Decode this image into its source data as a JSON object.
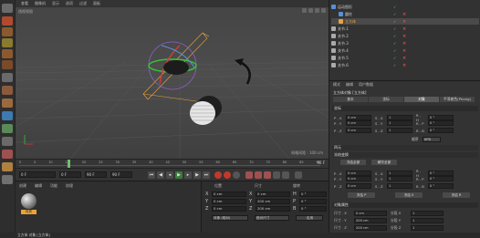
{
  "viewport": {
    "menu": [
      "查看",
      "摄像机",
      "显示",
      "选项",
      "过滤",
      "面板"
    ],
    "label": "透视视图",
    "info": "网格间距 : 100 cm"
  },
  "timeline": {
    "ticks": [
      "0",
      "5",
      "10",
      "15",
      "20",
      "25",
      "30",
      "35",
      "40",
      "45",
      "50",
      "55",
      "60",
      "65",
      "70",
      "75",
      "80",
      "85",
      "90"
    ],
    "frame_end": "90 F"
  },
  "transport": {
    "start": "0 F",
    "current": "0 F",
    "end": "90 F",
    "end2": "90 F"
  },
  "materials": {
    "menu": [
      "创建",
      "编辑",
      "功能",
      "纹理"
    ],
    "material_name": "材质"
  },
  "coords": {
    "headers": [
      "位置",
      "尺寸",
      "旋转"
    ],
    "rows": [
      {
        "axis": "X",
        "pos": "0 cm",
        "size": "0 cm",
        "rot_axis": "H",
        "rot": "0 °"
      },
      {
        "axis": "Y",
        "pos": "0 cm",
        "size": "200 cm",
        "rot_axis": "P",
        "rot": "0 °"
      },
      {
        "axis": "Z",
        "pos": "0 cm",
        "size": "200 cm",
        "rot_axis": "B",
        "rot": "0 °"
      }
    ],
    "mode1": "对象 (相对)",
    "mode2": "绝对尺寸",
    "apply": "应用"
  },
  "status": "立方体 对象 [立方体]",
  "objects": {
    "items": [
      {
        "name": "运动图形",
        "indent": 0,
        "color": "#5b8fd8"
      },
      {
        "name": "圆柱",
        "indent": 1,
        "color": "#5b8fd8"
      },
      {
        "name": "立方体",
        "indent": 1,
        "color": "#e8a33c",
        "selected": true
      },
      {
        "name": "关节.1",
        "indent": 0,
        "color": "#aaa"
      },
      {
        "name": "关节.2",
        "indent": 0,
        "color": "#aaa"
      },
      {
        "name": "关节.3",
        "indent": 0,
        "color": "#aaa"
      },
      {
        "name": "关节.4",
        "indent": 0,
        "color": "#aaa"
      },
      {
        "name": "关节.5",
        "indent": 0,
        "color": "#aaa"
      },
      {
        "name": "关节.6",
        "indent": 0,
        "color": "#aaa"
      }
    ]
  },
  "attributes": {
    "menu": [
      "模式",
      "编辑",
      "用户数据"
    ],
    "object_title": "立方体对象 [立方体]",
    "tabs": [
      "基本",
      "坐标",
      "对象",
      "平滑着色(Phong)"
    ],
    "coords_section": "坐标",
    "pos_rows": [
      {
        "p": "P . X",
        "pv": "0 cm",
        "s": "S . X",
        "sv": "1",
        "r": "R . H",
        "rv": "0 °"
      },
      {
        "p": "P . Y",
        "pv": "0 cm",
        "s": "S . Y",
        "sv": "1",
        "r": "R . P",
        "rv": "0 °"
      },
      {
        "p": "P . Z",
        "pv": "0 cm",
        "s": "S . Z",
        "sv": "1",
        "r": "R . B",
        "rv": "0 °"
      }
    ],
    "order_label": "顺序",
    "order_value": "HPB",
    "quat": "四元",
    "freeze_section": "冻结变换",
    "freeze_all": "冻结全部",
    "unfreeze_all": "解冻全部",
    "frozen_rows": [
      {
        "p": "P . X",
        "pv": "0 cm",
        "s": "S . X",
        "sv": "1",
        "r": "R . H",
        "rv": "0 °"
      },
      {
        "p": "P . Y",
        "pv": "0 cm",
        "s": "S . Y",
        "sv": "1",
        "r": "R . P",
        "rv": "0 °"
      },
      {
        "p": "P . Z",
        "pv": "0 cm",
        "s": "S . Z",
        "sv": "1",
        "r": "R . B",
        "rv": "0 °"
      }
    ],
    "freeze_p": "冻结 P",
    "freeze_s": "冻结 S",
    "freeze_r": "冻结 R",
    "object_section": "对象属性",
    "obj_rows": [
      {
        "l": "尺寸 . X",
        "v": "0 cm",
        "l2": "分段 X",
        "v2": "1"
      },
      {
        "l": "尺寸 . Y",
        "v": "200 cm",
        "l2": "分段 Y",
        "v2": "1"
      },
      {
        "l": "尺寸 . Z",
        "v": "200 cm",
        "l2": "分段 Z",
        "v2": "1"
      }
    ]
  }
}
